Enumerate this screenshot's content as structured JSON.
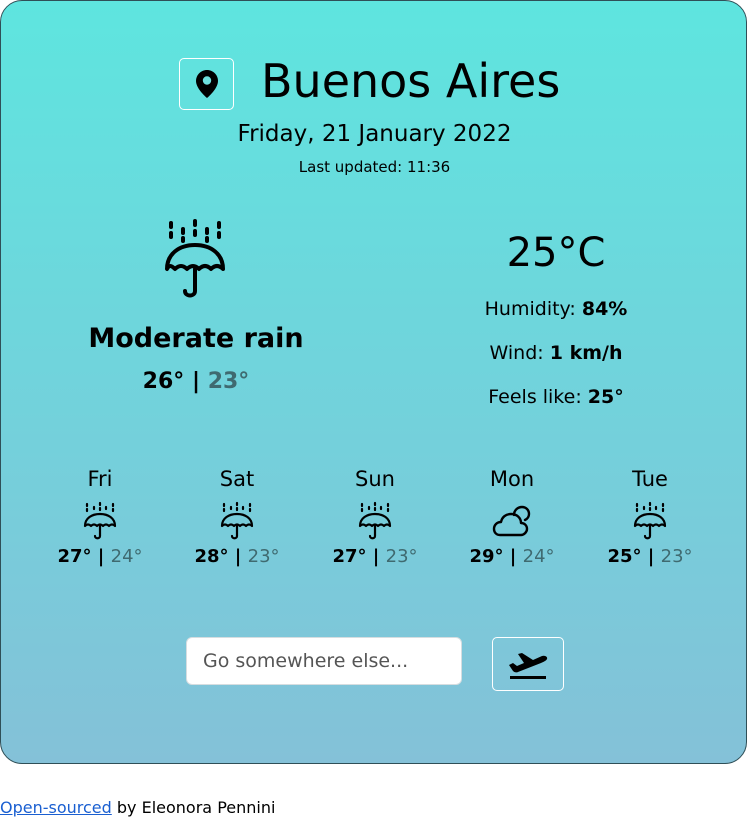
{
  "location": {
    "city": "Buenos Aires",
    "date": "Friday, 21 January 2022",
    "last_updated": "Last updated: 11:36"
  },
  "current": {
    "icon": "umbrella-rain-icon",
    "description": "Moderate rain",
    "high": "26°",
    "separator": "|",
    "low": "23°",
    "temperature": "25°C",
    "humidity_label": "Humidity:",
    "humidity_value": "84%",
    "wind_label": "Wind:",
    "wind_value": "1 km/h",
    "feels_label": "Feels like:",
    "feels_value": "25°"
  },
  "forecast": [
    {
      "day": "Fri",
      "icon": "umbrella-rain-icon",
      "high": "27°",
      "low": "24°"
    },
    {
      "day": "Sat",
      "icon": "umbrella-rain-icon",
      "high": "28°",
      "low": "23°"
    },
    {
      "day": "Sun",
      "icon": "umbrella-rain-icon",
      "high": "27°",
      "low": "23°"
    },
    {
      "day": "Mon",
      "icon": "cloud-sun-icon",
      "high": "29°",
      "low": "24°"
    },
    {
      "day": "Tue",
      "icon": "umbrella-rain-icon",
      "high": "25°",
      "low": "23°"
    }
  ],
  "search": {
    "placeholder": "Go somewhere else...",
    "value": ""
  },
  "footer": {
    "link_text": "Open-sourced",
    "text": "by Eleonora Pennini"
  },
  "colors": {
    "gradient_top": "#5ee5df",
    "gradient_bottom": "#84c1d8",
    "low_temp": "#3f6a70",
    "link": "#1a5fd1"
  }
}
